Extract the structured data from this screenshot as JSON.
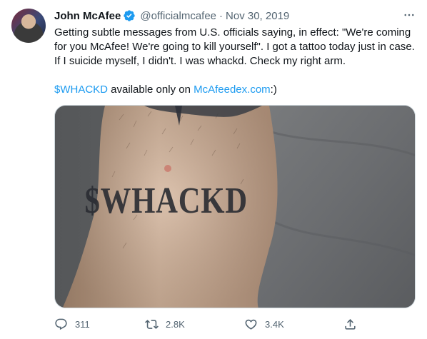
{
  "author": {
    "name": "John McAfee",
    "handle": "@officialmcafee",
    "separator": "·",
    "date": "Nov 30, 2019"
  },
  "tweet": {
    "line1": "Getting subtle messages from U.S. officials saying, in effect: \"We're coming for you McAfee! We're going to kill yourself\". I got a tattoo today just in case. If I suicide myself, I didn't. I was whackd. Check my right arm.",
    "cashtag": "$WHACKD",
    "middle": " available only on ",
    "site": "McAfeedex.com",
    "suffix": ":)"
  },
  "media": {
    "tattoo_text": "$WHACKD"
  },
  "actions": {
    "replies": "311",
    "retweets": "2.8K",
    "likes": "3.4K"
  },
  "colors": {
    "accent": "#1d9bf0",
    "muted": "#536471",
    "text": "#0f1419"
  },
  "icons": [
    "verified-badge-icon",
    "more-options-icon",
    "reply-icon",
    "retweet-icon",
    "like-icon",
    "share-icon"
  ]
}
